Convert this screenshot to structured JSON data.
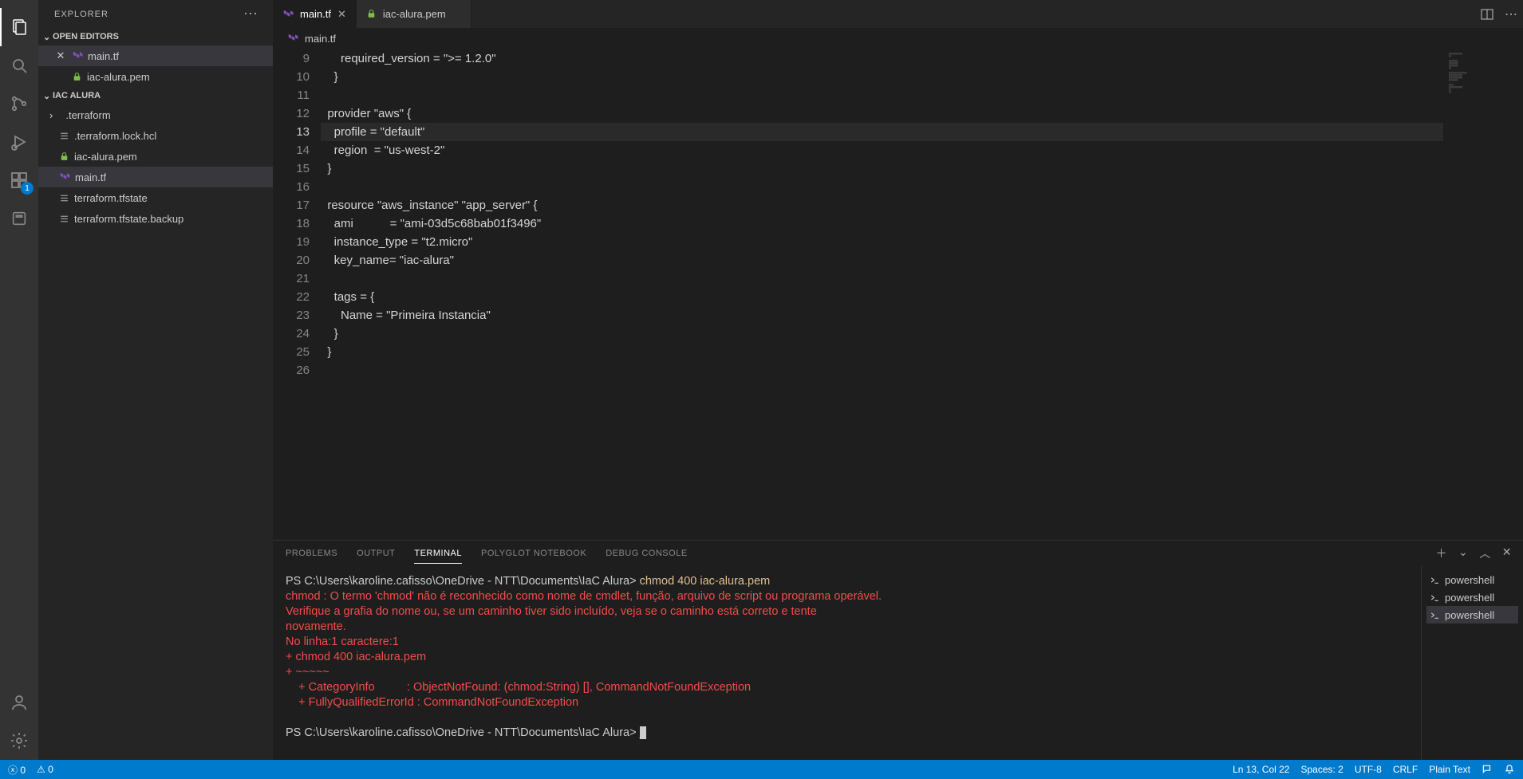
{
  "sidebar": {
    "title": "EXPLORER",
    "openEditors": {
      "label": "OPEN EDITORS",
      "items": [
        {
          "name": "main.tf",
          "icon": "tf"
        },
        {
          "name": "iac-alura.pem",
          "icon": "lock"
        }
      ]
    },
    "project": {
      "name": "IAC ALURA",
      "files": [
        {
          "name": ".terraform",
          "icon": "folder"
        },
        {
          "name": ".terraform.lock.hcl",
          "icon": "list"
        },
        {
          "name": "iac-alura.pem",
          "icon": "lock"
        },
        {
          "name": "main.tf",
          "icon": "tf",
          "selected": true
        },
        {
          "name": "terraform.tfstate",
          "icon": "list"
        },
        {
          "name": "terraform.tfstate.backup",
          "icon": "list"
        }
      ]
    }
  },
  "tabs": [
    {
      "label": "main.tf",
      "icon": "tf",
      "active": true
    },
    {
      "label": "iac-alura.pem",
      "icon": "lock",
      "active": false
    }
  ],
  "breadcrumb": {
    "icon": "tf",
    "label": "main.tf"
  },
  "code": {
    "startLine": 9,
    "highlight": 13,
    "lines": [
      "    required_version = \">= 1.2.0\"",
      "  }",
      "",
      "provider \"aws\" {",
      "  profile = \"default\"",
      "  region  = \"us-west-2\"",
      "}",
      "",
      "resource \"aws_instance\" \"app_server\" {",
      "  ami           = \"ami-03d5c68bab01f3496\"",
      "  instance_type = \"t2.micro\"",
      "  key_name= \"iac-alura\"",
      "",
      "  tags = {",
      "    Name = \"Primeira Instancia\"",
      "  }",
      "}",
      ""
    ]
  },
  "panel": {
    "tabs": [
      "PROBLEMS",
      "OUTPUT",
      "TERMINAL",
      "POLYGLOT NOTEBOOK",
      "DEBUG CONSOLE"
    ],
    "activeTab": 2,
    "terminal": {
      "prompt1": "PS C:\\Users\\karoline.cafisso\\OneDrive - NTT\\Documents\\IaC Alura> ",
      "cmd1": "chmod 400 iac-alura.pem",
      "error": "chmod : O termo 'chmod' não é reconhecido como nome de cmdlet, função, arquivo de script ou programa operável.\nVerifique a grafia do nome ou, se um caminho tiver sido incluído, veja se o caminho está correto e tente\nnovamente.\nNo linha:1 caractere:1\n+ chmod 400 iac-alura.pem\n+ ~~~~~\n    + CategoryInfo          : ObjectNotFound: (chmod:String) [], CommandNotFoundException\n    + FullyQualifiedErrorId : CommandNotFoundException",
      "prompt2": "PS C:\\Users\\karoline.cafisso\\OneDrive - NTT\\Documents\\IaC Alura> "
    },
    "terminals": [
      "powershell",
      "powershell",
      "powershell"
    ],
    "selectedTerminal": 2
  },
  "statusbar": {
    "errors": "0",
    "warnings": "0",
    "pos": "Ln 13, Col 22",
    "spaces": "Spaces: 2",
    "encoding": "UTF-8",
    "eol": "CRLF",
    "lang": "Plain Text"
  },
  "extensionsBadge": "1"
}
